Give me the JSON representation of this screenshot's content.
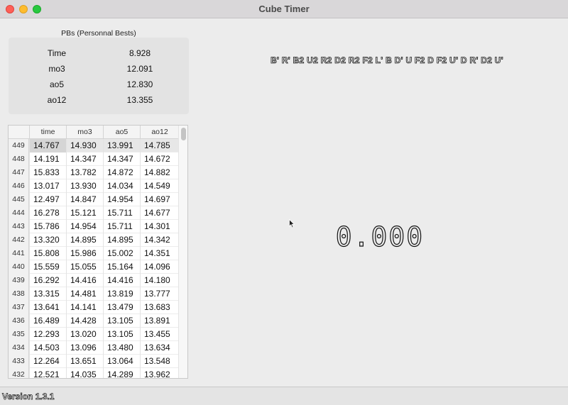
{
  "window": {
    "title": "Cube Timer"
  },
  "pb": {
    "title": "PBs (Personnal Bests)",
    "rows": [
      {
        "label": "Time",
        "value": "8.928"
      },
      {
        "label": "mo3",
        "value": "12.091"
      },
      {
        "label": "ao5",
        "value": "12.830"
      },
      {
        "label": "ao12",
        "value": "13.355"
      }
    ]
  },
  "table": {
    "columns": [
      "time",
      "mo3",
      "ao5",
      "ao12"
    ],
    "rows": [
      {
        "n": "449",
        "cells": [
          "14.767",
          "14.930",
          "13.991",
          "14.785"
        ]
      },
      {
        "n": "448",
        "cells": [
          "14.191",
          "14.347",
          "14.347",
          "14.672"
        ]
      },
      {
        "n": "447",
        "cells": [
          "15.833",
          "13.782",
          "14.872",
          "14.882"
        ]
      },
      {
        "n": "446",
        "cells": [
          "13.017",
          "13.930",
          "14.034",
          "14.549"
        ]
      },
      {
        "n": "445",
        "cells": [
          "12.497",
          "14.847",
          "14.954",
          "14.697"
        ]
      },
      {
        "n": "444",
        "cells": [
          "16.278",
          "15.121",
          "15.711",
          "14.677"
        ]
      },
      {
        "n": "443",
        "cells": [
          "15.786",
          "14.954",
          "15.711",
          "14.301"
        ]
      },
      {
        "n": "442",
        "cells": [
          "13.320",
          "14.895",
          "14.895",
          "14.342"
        ]
      },
      {
        "n": "441",
        "cells": [
          "15.808",
          "15.986",
          "15.002",
          "14.351"
        ]
      },
      {
        "n": "440",
        "cells": [
          "15.559",
          "15.055",
          "15.164",
          "14.096"
        ]
      },
      {
        "n": "439",
        "cells": [
          "16.292",
          "14.416",
          "14.416",
          "14.180"
        ]
      },
      {
        "n": "438",
        "cells": [
          "13.315",
          "14.481",
          "13.819",
          "13.777"
        ]
      },
      {
        "n": "437",
        "cells": [
          "13.641",
          "14.141",
          "13.479",
          "13.683"
        ]
      },
      {
        "n": "436",
        "cells": [
          "16.489",
          "14.428",
          "13.105",
          "13.891"
        ]
      },
      {
        "n": "435",
        "cells": [
          "12.293",
          "13.020",
          "13.105",
          "13.455"
        ]
      },
      {
        "n": "434",
        "cells": [
          "14.503",
          "13.096",
          "13.480",
          "13.634"
        ]
      },
      {
        "n": "433",
        "cells": [
          "12.264",
          "13.651",
          "13.064",
          "13.548"
        ]
      },
      {
        "n": "432",
        "cells": [
          "12.521",
          "14.035",
          "14.289",
          "13.962"
        ]
      }
    ]
  },
  "scramble": "B' R' B2 U2 R2 D2 R2 F2 L' B D' U F2 D F2 U' D R' D2 U'",
  "timer": "0.000",
  "status": {
    "version": "Version 1.3.1"
  },
  "icons": {
    "cursor": "arrow-cursor-icon"
  }
}
